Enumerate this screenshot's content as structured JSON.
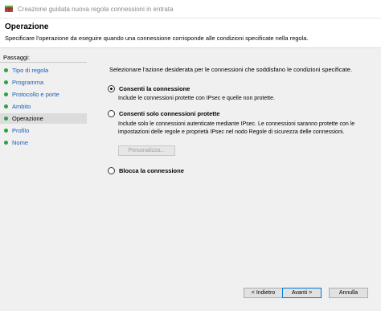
{
  "window": {
    "title": "Creazione guidata nuova regola connessioni in entrata"
  },
  "header": {
    "title": "Operazione",
    "subtitle": "Specificare l'operazione da eseguire quando una connessione corrisponde alle condizioni specificate nella regola."
  },
  "steps": {
    "label": "Passaggi:",
    "items": [
      {
        "label": "Tipo di regola"
      },
      {
        "label": "Programma"
      },
      {
        "label": "Protocollo e porte"
      },
      {
        "label": "Ambito"
      },
      {
        "label": "Operazione"
      },
      {
        "label": "Profilo"
      },
      {
        "label": "Nome"
      }
    ],
    "current_index": 4
  },
  "main": {
    "intro": "Selezionare l'azione desiderata per le connessioni che soddisfano le condizioni specificate.",
    "options": [
      {
        "label": "Consenti la connessione",
        "description": "Include le connessioni protette con IPsec e quelle non protette.",
        "checked": true
      },
      {
        "label": "Consenti solo connessioni protette",
        "description": "Include solo le connessioni autenticate mediante IPsec. Le connessioni saranno protette con le impostazioni delle regole e proprietà IPsec nel nodo Regole di sicurezza delle connessioni.",
        "checked": false
      },
      {
        "label": "Blocca la connessione",
        "description": "",
        "checked": false
      }
    ],
    "customize_button": "Personalizza..."
  },
  "footer": {
    "back_button": "< Indietro",
    "next_button": "Avanti >",
    "cancel_button": "Annulla"
  },
  "colors": {
    "step_dot": "#2ea043",
    "link": "#1a5fb4",
    "accent": "#0078d7"
  }
}
